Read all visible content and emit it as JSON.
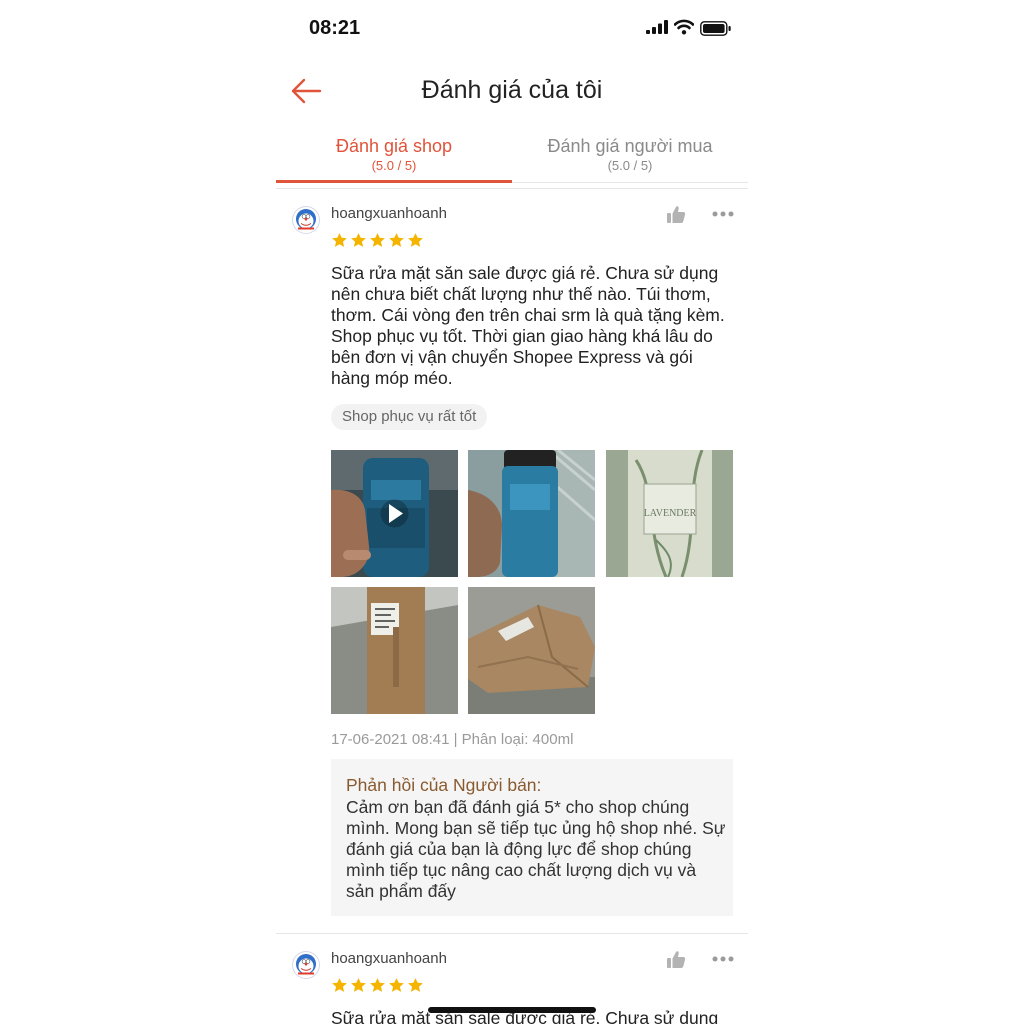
{
  "status_bar": {
    "time": "08:21"
  },
  "header": {
    "title": "Đánh giá của tôi"
  },
  "tabs": [
    {
      "label": "Đánh giá shop",
      "sub": "(5.0 / 5)",
      "active": true
    },
    {
      "label": "Đánh giá người mua",
      "sub": "(5.0 / 5)",
      "active": false
    }
  ],
  "colors": {
    "accent": "#e0543a",
    "star": "#f5b400",
    "reply_title": "#8a5a2f"
  },
  "reviews": [
    {
      "username": "hoangxuanhoanh",
      "rating": 5,
      "text": "Sữa rửa mặt săn sale được giá rẻ. Chưa sử dụng nên chưa biết chất lượng như thế nào. Túi thơm, thơm. Cái vòng đen trên chai srm là quà tặng kèm. Shop phục vụ tốt.  Thời gian giao hàng khá lâu do bên đơn vị vận chuyển Shopee Express và gói hàng móp méo.",
      "tag": "Shop phục vụ rất tốt",
      "photos": [
        {
          "icon": "product-video-thumbnail"
        },
        {
          "icon": "product-photo-bottle"
        },
        {
          "text": "LAVENDER"
        },
        {
          "icon": "package-photo"
        },
        {
          "icon": "package-photo-dented"
        }
      ],
      "meta": "17-06-2021 08:41 | Phân loại: 400ml",
      "reply_title": "Phản hồi của Người bán:",
      "reply_text": "Cảm ơn bạn đã đánh giá 5* cho shop chúng mình. Mong bạn sẽ tiếp tục ủng hộ shop nhé. Sự đánh giá của bạn là động lực để shop chúng mình tiếp tục nâng cao chất lượng dịch vụ và sản phẩm đấy"
    },
    {
      "username": "hoangxuanhoanh",
      "rating": 5,
      "text": "Sữa rửa mặt săn sale được giá rẻ. Chưa sử dụng"
    }
  ]
}
